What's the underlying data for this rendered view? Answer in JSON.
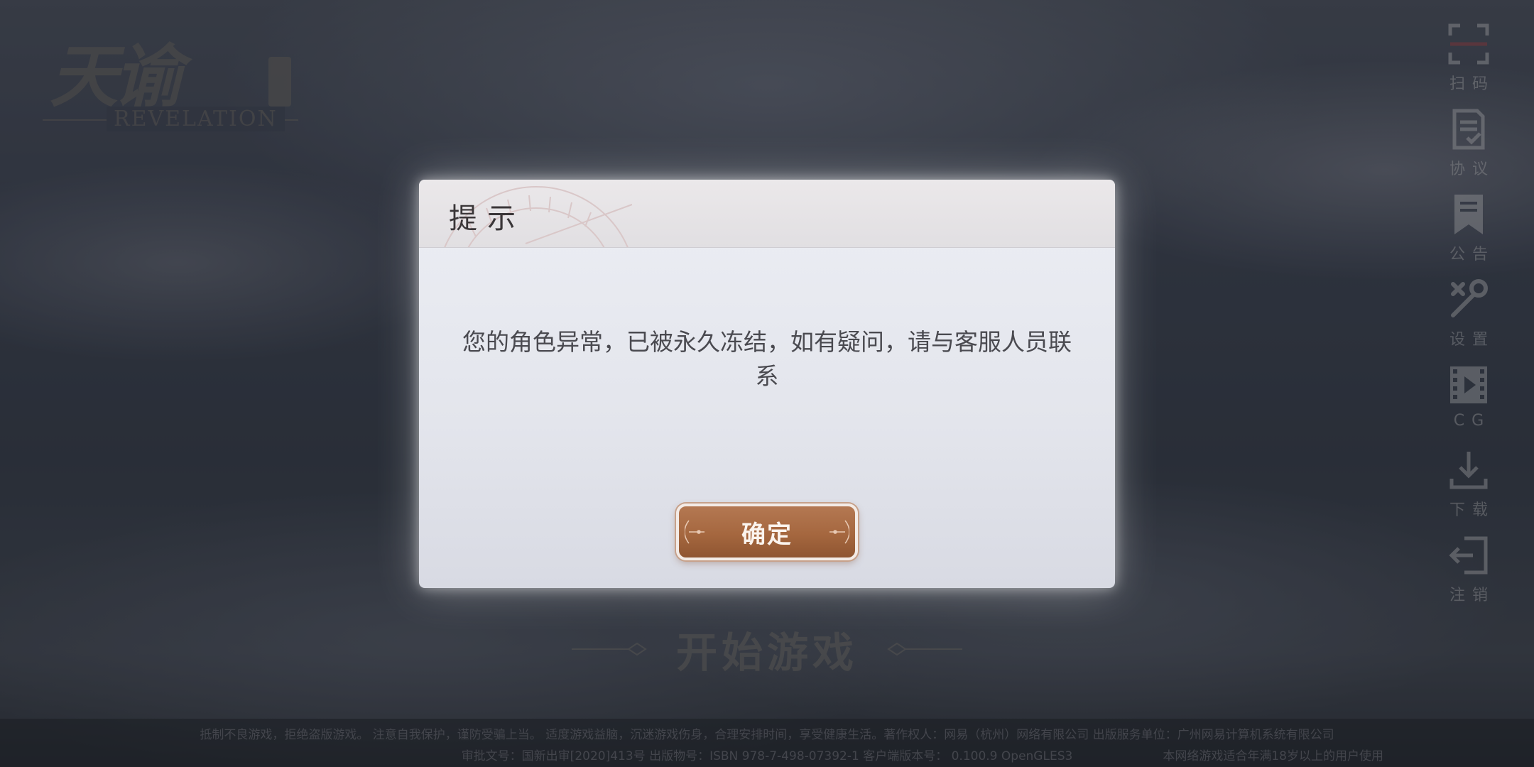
{
  "logo": {
    "title_cn": "天谕",
    "title_en": "REVELATION"
  },
  "sidebar": {
    "items": [
      {
        "label": "扫码",
        "icon": "scan-icon"
      },
      {
        "label": "协议",
        "icon": "agreement-icon"
      },
      {
        "label": "公告",
        "icon": "notice-icon"
      },
      {
        "label": "设置",
        "icon": "wrench-icon"
      },
      {
        "label": "CG",
        "icon": "film-icon"
      },
      {
        "label": "下载",
        "icon": "download-icon"
      },
      {
        "label": "注销",
        "icon": "logout-icon"
      }
    ]
  },
  "start_game": {
    "label": "开始游戏"
  },
  "footer": {
    "line1": "抵制不良游戏，拒绝盗版游戏。 注意自我保护，谨防受骗上当。 适度游戏益脑，沉迷游戏伤身，合理安排时间，享受健康生活。著作权人：网易（杭州）网络有限公司 出版服务单位：广州网易计算机系统有限公司",
    "line2": "审批文号：国新出审[2020]413号 出版物号：ISBN 978-7-498-07392-1 客户端版本号： 0.100.9 OpenGLES3",
    "age_notice": "本网络游戏适合年满18岁以上的用户使用"
  },
  "dialog": {
    "title": "提示",
    "message": "您的角色异常，已被永久冻结，如有疑问，请与客服人员联系",
    "confirm_label": "确定"
  },
  "colors": {
    "button": "#a5673f",
    "dialog_bg": "#e6e8ee",
    "title_text": "#3a3638"
  }
}
